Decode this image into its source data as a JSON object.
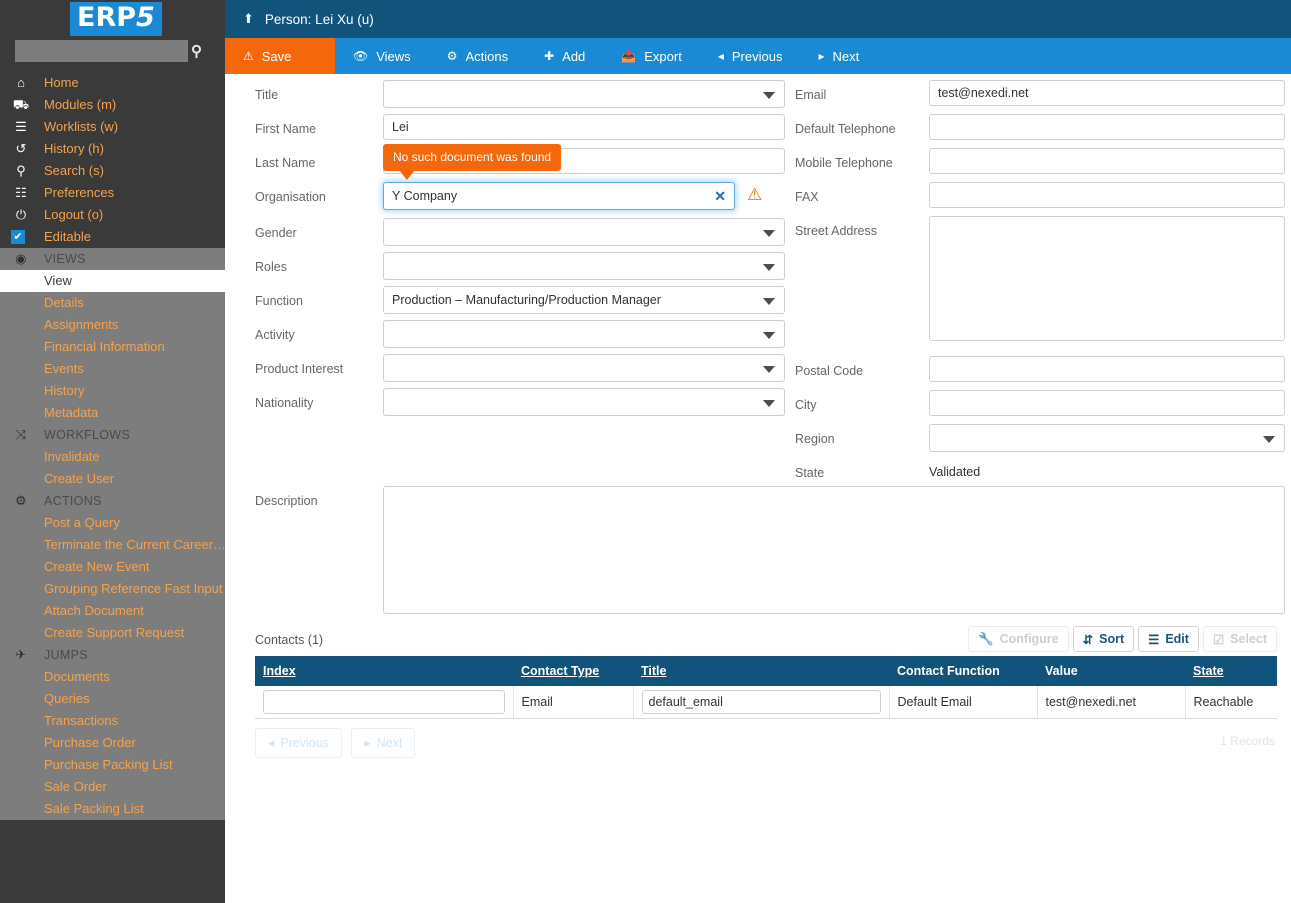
{
  "brand": {
    "logo_text": "ERP",
    "logo_suffix": "5"
  },
  "search": {
    "value": "",
    "placeholder": "",
    "icon": "search-icon"
  },
  "sidebar": {
    "top_items": [
      {
        "label": "Home",
        "icon": "home-icon",
        "glyph": "⌂"
      },
      {
        "label": "Modules (m)",
        "icon": "modules-icon",
        "glyph": "⛟"
      },
      {
        "label": "Worklists (w)",
        "icon": "worklists-icon",
        "glyph": "☰"
      },
      {
        "label": "History (h)",
        "icon": "history-icon",
        "glyph": "↺"
      },
      {
        "label": "Search (s)",
        "icon": "search-icon",
        "glyph": "⚲"
      },
      {
        "label": "Preferences",
        "icon": "sliders-icon",
        "glyph": "☷"
      },
      {
        "label": "Logout (o)",
        "icon": "power-icon",
        "glyph": "⏻"
      },
      {
        "label": "Editable",
        "icon": "checkbox-checked-icon",
        "glyph": "✔"
      }
    ],
    "sections": [
      {
        "title": "VIEWS",
        "icon": "eye-icon",
        "glyph": "◉",
        "items": [
          {
            "label": "View",
            "active": true
          },
          {
            "label": "Details",
            "active": false
          },
          {
            "label": "Assignments",
            "active": false
          },
          {
            "label": "Financial Information",
            "active": false
          },
          {
            "label": "Events",
            "active": false
          },
          {
            "label": "History",
            "active": false
          },
          {
            "label": "Metadata",
            "active": false
          }
        ]
      },
      {
        "title": "WORKFLOWS",
        "icon": "shuffle-icon",
        "glyph": "⤨",
        "items": [
          {
            "label": "Invalidate",
            "active": false
          },
          {
            "label": "Create User",
            "active": false
          }
        ]
      },
      {
        "title": "ACTIONS",
        "icon": "gear-icon",
        "glyph": "⚙",
        "items": [
          {
            "label": "Post a Query",
            "active": false
          },
          {
            "label": "Terminate the Current Career…",
            "active": false
          },
          {
            "label": "Create New Event",
            "active": false
          },
          {
            "label": "Grouping Reference Fast Input",
            "active": false
          },
          {
            "label": "Attach Document",
            "active": false
          },
          {
            "label": "Create Support Request",
            "active": false
          }
        ]
      },
      {
        "title": "JUMPS",
        "icon": "airplane-icon",
        "glyph": "✈",
        "items": [
          {
            "label": "Documents",
            "active": false
          },
          {
            "label": "Queries",
            "active": false
          },
          {
            "label": "Transactions",
            "active": false
          },
          {
            "label": "Purchase Order",
            "active": false
          },
          {
            "label": "Purchase Packing List",
            "active": false
          },
          {
            "label": "Sale Order",
            "active": false
          },
          {
            "label": "Sale Packing List",
            "active": false
          }
        ]
      }
    ]
  },
  "header": {
    "title": "Person: Lei Xu (u)",
    "up_icon": "up-arrow-icon"
  },
  "toolbar": {
    "save_label": "Save",
    "views_label": "Views",
    "actions_label": "Actions",
    "add_label": "Add",
    "export_label": "Export",
    "previous_label": "Previous",
    "next_label": "Next"
  },
  "form": {
    "left": {
      "title_label": "Title",
      "title_value": "",
      "first_name_label": "First Name",
      "first_name_value": "Lei",
      "last_name_label": "Last Name",
      "last_name_value": "",
      "organisation_label": "Organisation",
      "organisation_value": "Y Company",
      "organisation_error": "No such document was found",
      "gender_label": "Gender",
      "gender_value": "",
      "roles_label": "Roles",
      "roles_value": "",
      "function_label": "Function",
      "function_value": "Production – Manufacturing/Production Manager",
      "activity_label": "Activity",
      "activity_value": "",
      "product_interest_label": "Product Interest",
      "product_interest_value": "",
      "nationality_label": "Nationality",
      "nationality_value": "",
      "description_label": "Description",
      "description_value": ""
    },
    "right": {
      "email_label": "Email",
      "email_value": "test@nexedi.net",
      "default_telephone_label": "Default Telephone",
      "default_telephone_value": "",
      "mobile_telephone_label": "Mobile Telephone",
      "mobile_telephone_value": "",
      "fax_label": "FAX",
      "fax_value": "",
      "street_address_label": "Street Address",
      "street_address_value": "",
      "postal_code_label": "Postal Code",
      "postal_code_value": "",
      "city_label": "City",
      "city_value": "",
      "region_label": "Region",
      "region_value": "",
      "state_label": "State",
      "state_value": "Validated"
    }
  },
  "listbox": {
    "title": "Contacts (1)",
    "buttons": {
      "configure": "Configure",
      "sort": "Sort",
      "edit": "Edit",
      "select": "Select"
    },
    "columns": [
      "Index",
      "Contact Type",
      "Title",
      "Contact Function",
      "Value",
      "State"
    ],
    "rows": [
      {
        "index": "",
        "contact_type": "Email",
        "title": "default_email",
        "contact_function": "Default Email",
        "value": "test@nexedi.net",
        "state": "Reachable"
      }
    ],
    "pagination": {
      "previous": "Previous",
      "next": "Next",
      "records": "1 Records"
    }
  },
  "colors": {
    "brand_blue": "#1a8ad4",
    "header_dark_blue": "#12537c",
    "accent_orange": "#f4670b",
    "sidebar_dark": "#3a3a3a",
    "sidebar_gray": "#7d7d7d",
    "link_orange": "#f4a24e"
  }
}
